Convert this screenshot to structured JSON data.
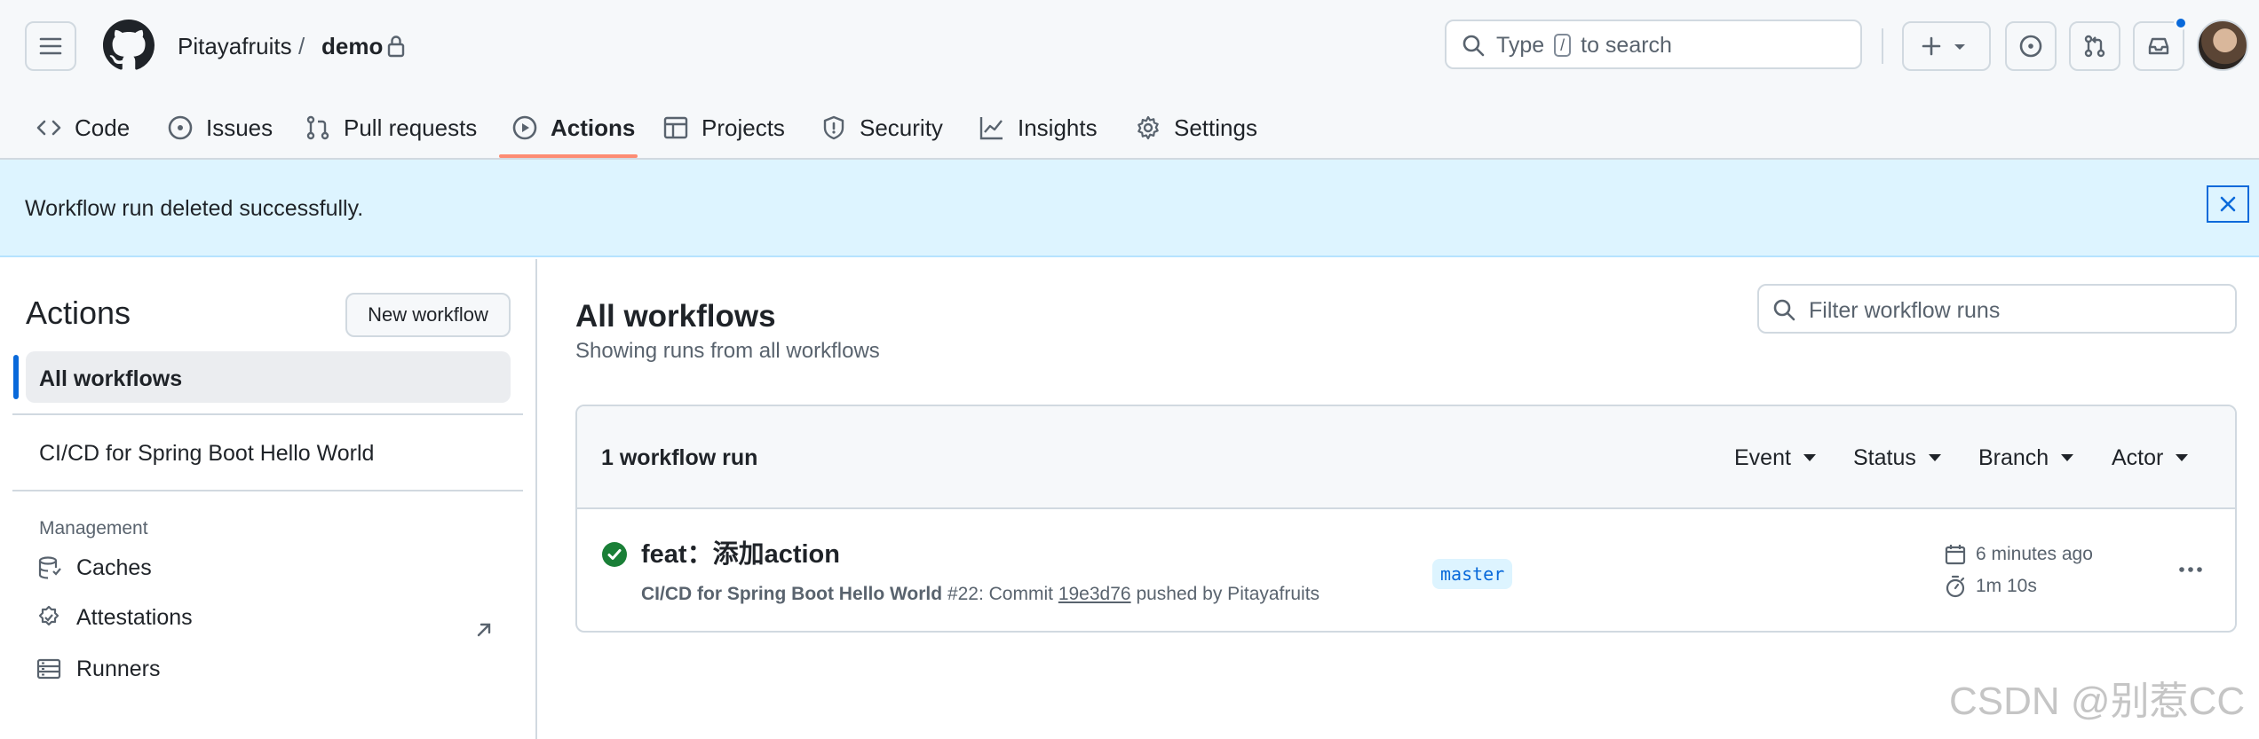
{
  "header": {
    "owner": "Pitayafruits",
    "separator": "/",
    "repo": "demo",
    "search": {
      "prefix": "Type",
      "key": "/",
      "suffix": "to search"
    },
    "icons": [
      "hamburger-icon",
      "github-logo-icon",
      "lock-icon",
      "search-icon",
      "plus-icon",
      "chevron-down-icon",
      "issue-opened-icon",
      "pull-request-icon",
      "inbox-icon"
    ],
    "notification_color": "#0969da"
  },
  "tabs": [
    {
      "label": "Code",
      "icon": "code-icon"
    },
    {
      "label": "Issues",
      "icon": "issue-opened-icon"
    },
    {
      "label": "Pull requests",
      "icon": "pull-request-icon"
    },
    {
      "label": "Actions",
      "icon": "play-icon",
      "selected": true
    },
    {
      "label": "Projects",
      "icon": "table-icon"
    },
    {
      "label": "Security",
      "icon": "shield-icon"
    },
    {
      "label": "Insights",
      "icon": "graph-icon"
    },
    {
      "label": "Settings",
      "icon": "gear-icon"
    }
  ],
  "flash": {
    "message": "Workflow run deleted successfully."
  },
  "sidebar": {
    "title": "Actions",
    "new_workflow": "New workflow",
    "all_workflows": "All workflows",
    "workflows": [
      "CI/CD for Spring Boot Hello World"
    ],
    "management_label": "Management",
    "management": [
      {
        "label": "Caches",
        "icon": "database-icon"
      },
      {
        "label": "Attestations",
        "icon": "verified-icon"
      },
      {
        "label": "Runners",
        "icon": "server-icon"
      }
    ]
  },
  "main": {
    "title": "All workflows",
    "subtitle": "Showing runs from all workflows",
    "filter_placeholder": "Filter workflow runs",
    "run_count": "1 workflow run",
    "filters": [
      "Event",
      "Status",
      "Branch",
      "Actor"
    ],
    "runs": [
      {
        "title": "feat：添加action",
        "workflow": "CI/CD for Spring Boot Hello World",
        "number": "#22: Commit",
        "commit": "19e3d76",
        "pushed_by": "pushed by Pitayafruits",
        "branch": "master",
        "when": "6 minutes ago",
        "duration": "1m 10s",
        "status": "success",
        "status_color": "#1a7f37"
      }
    ]
  },
  "watermark": "CSDN @别惹CC",
  "colors": {
    "accent": "#0969da",
    "tab_underline": "#fd8c73",
    "flash_bg": "#ddf4ff"
  }
}
